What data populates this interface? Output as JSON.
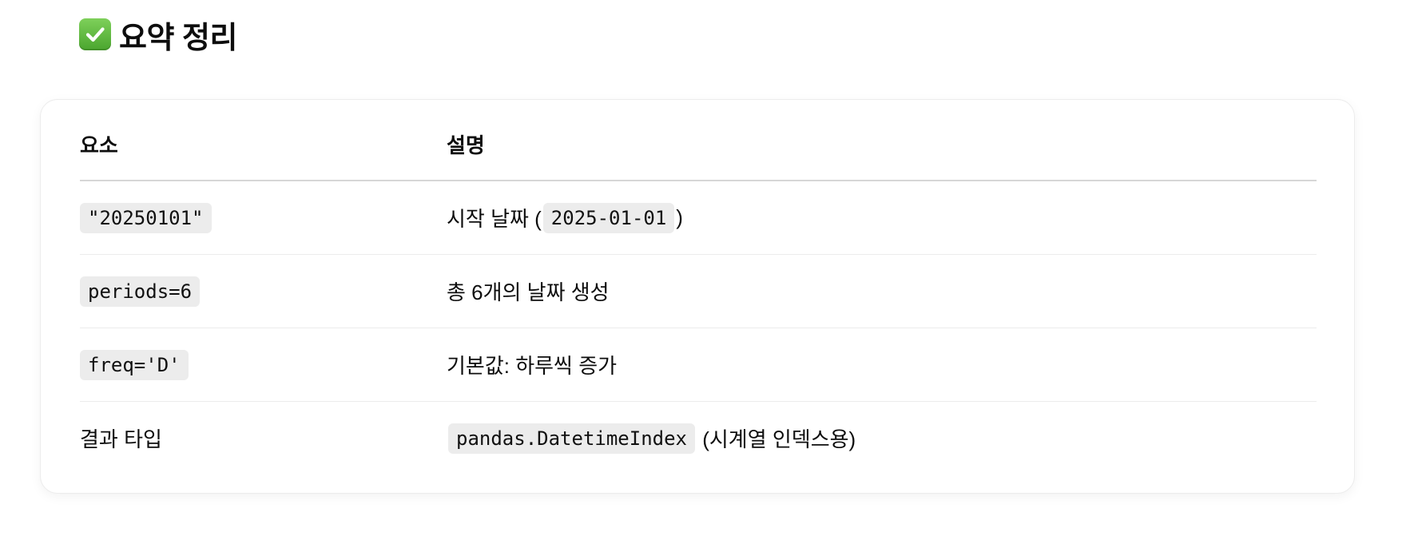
{
  "heading": {
    "icon": "check-mark-button-icon",
    "title": "요약 정리"
  },
  "table": {
    "headers": [
      "요소",
      "설명"
    ],
    "rows": [
      {
        "element": "\"20250101\"",
        "description_prefix": "시작 날짜 (",
        "description_code": "2025-01-01",
        "description_suffix": ")"
      },
      {
        "element": "periods=6",
        "description": "총 6개의 날짜 생성"
      },
      {
        "element": "freq='D'",
        "description": "기본값: 하루씩 증가"
      },
      {
        "element": "결과 타입",
        "description_code": "pandas.DatetimeIndex",
        "description_suffix": " (시계열 인덱스용)"
      }
    ]
  },
  "colors": {
    "check_icon": "#5bb83b",
    "code_background": "#ececec",
    "border": "#ececec"
  }
}
